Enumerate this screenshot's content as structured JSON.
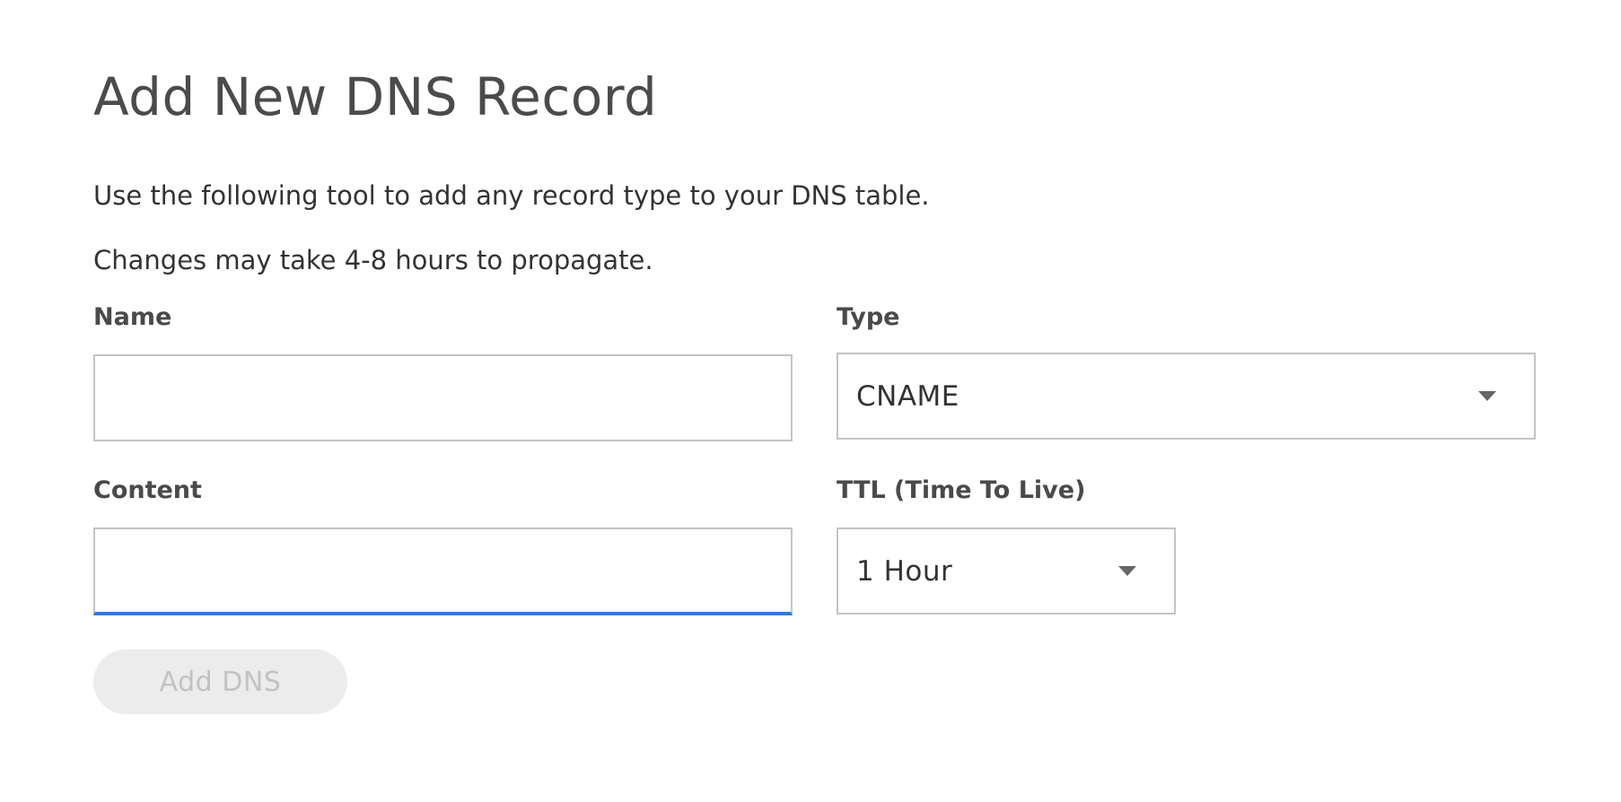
{
  "form": {
    "title": "Add New DNS Record",
    "description_1": "Use the following tool to add any record type to your DNS table.",
    "description_2": "Changes may take 4-8 hours to propagate.",
    "name": {
      "label": "Name",
      "value": ""
    },
    "type": {
      "label": "Type",
      "selected": "CNAME"
    },
    "content": {
      "label": "Content",
      "value": ""
    },
    "ttl": {
      "label": "TTL (Time To Live)",
      "selected": "1 Hour"
    },
    "submit_label": "Add DNS",
    "submit_disabled": true
  },
  "colors": {
    "focus_underline": "#2e7ccf",
    "button_disabled_bg": "#ececec",
    "button_disabled_text": "#c2c2c2"
  },
  "icons": {
    "dropdown": "caret-down-icon"
  }
}
